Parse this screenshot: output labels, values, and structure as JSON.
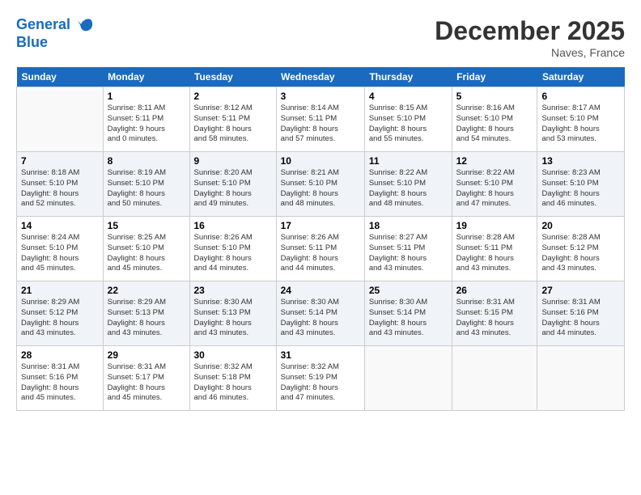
{
  "logo": {
    "line1": "General",
    "line2": "Blue"
  },
  "title": "December 2025",
  "location": "Naves, France",
  "days_of_week": [
    "Sunday",
    "Monday",
    "Tuesday",
    "Wednesday",
    "Thursday",
    "Friday",
    "Saturday"
  ],
  "weeks": [
    [
      {
        "day": "",
        "info": ""
      },
      {
        "day": "1",
        "info": "Sunrise: 8:11 AM\nSunset: 5:11 PM\nDaylight: 9 hours\nand 0 minutes."
      },
      {
        "day": "2",
        "info": "Sunrise: 8:12 AM\nSunset: 5:11 PM\nDaylight: 8 hours\nand 58 minutes."
      },
      {
        "day": "3",
        "info": "Sunrise: 8:14 AM\nSunset: 5:11 PM\nDaylight: 8 hours\nand 57 minutes."
      },
      {
        "day": "4",
        "info": "Sunrise: 8:15 AM\nSunset: 5:10 PM\nDaylight: 8 hours\nand 55 minutes."
      },
      {
        "day": "5",
        "info": "Sunrise: 8:16 AM\nSunset: 5:10 PM\nDaylight: 8 hours\nand 54 minutes."
      },
      {
        "day": "6",
        "info": "Sunrise: 8:17 AM\nSunset: 5:10 PM\nDaylight: 8 hours\nand 53 minutes."
      }
    ],
    [
      {
        "day": "7",
        "info": "Sunrise: 8:18 AM\nSunset: 5:10 PM\nDaylight: 8 hours\nand 52 minutes."
      },
      {
        "day": "8",
        "info": "Sunrise: 8:19 AM\nSunset: 5:10 PM\nDaylight: 8 hours\nand 50 minutes."
      },
      {
        "day": "9",
        "info": "Sunrise: 8:20 AM\nSunset: 5:10 PM\nDaylight: 8 hours\nand 49 minutes."
      },
      {
        "day": "10",
        "info": "Sunrise: 8:21 AM\nSunset: 5:10 PM\nDaylight: 8 hours\nand 48 minutes."
      },
      {
        "day": "11",
        "info": "Sunrise: 8:22 AM\nSunset: 5:10 PM\nDaylight: 8 hours\nand 48 minutes."
      },
      {
        "day": "12",
        "info": "Sunrise: 8:22 AM\nSunset: 5:10 PM\nDaylight: 8 hours\nand 47 minutes."
      },
      {
        "day": "13",
        "info": "Sunrise: 8:23 AM\nSunset: 5:10 PM\nDaylight: 8 hours\nand 46 minutes."
      }
    ],
    [
      {
        "day": "14",
        "info": "Sunrise: 8:24 AM\nSunset: 5:10 PM\nDaylight: 8 hours\nand 45 minutes."
      },
      {
        "day": "15",
        "info": "Sunrise: 8:25 AM\nSunset: 5:10 PM\nDaylight: 8 hours\nand 45 minutes."
      },
      {
        "day": "16",
        "info": "Sunrise: 8:26 AM\nSunset: 5:10 PM\nDaylight: 8 hours\nand 44 minutes."
      },
      {
        "day": "17",
        "info": "Sunrise: 8:26 AM\nSunset: 5:11 PM\nDaylight: 8 hours\nand 44 minutes."
      },
      {
        "day": "18",
        "info": "Sunrise: 8:27 AM\nSunset: 5:11 PM\nDaylight: 8 hours\nand 43 minutes."
      },
      {
        "day": "19",
        "info": "Sunrise: 8:28 AM\nSunset: 5:11 PM\nDaylight: 8 hours\nand 43 minutes."
      },
      {
        "day": "20",
        "info": "Sunrise: 8:28 AM\nSunset: 5:12 PM\nDaylight: 8 hours\nand 43 minutes."
      }
    ],
    [
      {
        "day": "21",
        "info": "Sunrise: 8:29 AM\nSunset: 5:12 PM\nDaylight: 8 hours\nand 43 minutes."
      },
      {
        "day": "22",
        "info": "Sunrise: 8:29 AM\nSunset: 5:13 PM\nDaylight: 8 hours\nand 43 minutes."
      },
      {
        "day": "23",
        "info": "Sunrise: 8:30 AM\nSunset: 5:13 PM\nDaylight: 8 hours\nand 43 minutes."
      },
      {
        "day": "24",
        "info": "Sunrise: 8:30 AM\nSunset: 5:14 PM\nDaylight: 8 hours\nand 43 minutes."
      },
      {
        "day": "25",
        "info": "Sunrise: 8:30 AM\nSunset: 5:14 PM\nDaylight: 8 hours\nand 43 minutes."
      },
      {
        "day": "26",
        "info": "Sunrise: 8:31 AM\nSunset: 5:15 PM\nDaylight: 8 hours\nand 43 minutes."
      },
      {
        "day": "27",
        "info": "Sunrise: 8:31 AM\nSunset: 5:16 PM\nDaylight: 8 hours\nand 44 minutes."
      }
    ],
    [
      {
        "day": "28",
        "info": "Sunrise: 8:31 AM\nSunset: 5:16 PM\nDaylight: 8 hours\nand 45 minutes."
      },
      {
        "day": "29",
        "info": "Sunrise: 8:31 AM\nSunset: 5:17 PM\nDaylight: 8 hours\nand 45 minutes."
      },
      {
        "day": "30",
        "info": "Sunrise: 8:32 AM\nSunset: 5:18 PM\nDaylight: 8 hours\nand 46 minutes."
      },
      {
        "day": "31",
        "info": "Sunrise: 8:32 AM\nSunset: 5:19 PM\nDaylight: 8 hours\nand 47 minutes."
      },
      {
        "day": "",
        "info": ""
      },
      {
        "day": "",
        "info": ""
      },
      {
        "day": "",
        "info": ""
      }
    ]
  ]
}
